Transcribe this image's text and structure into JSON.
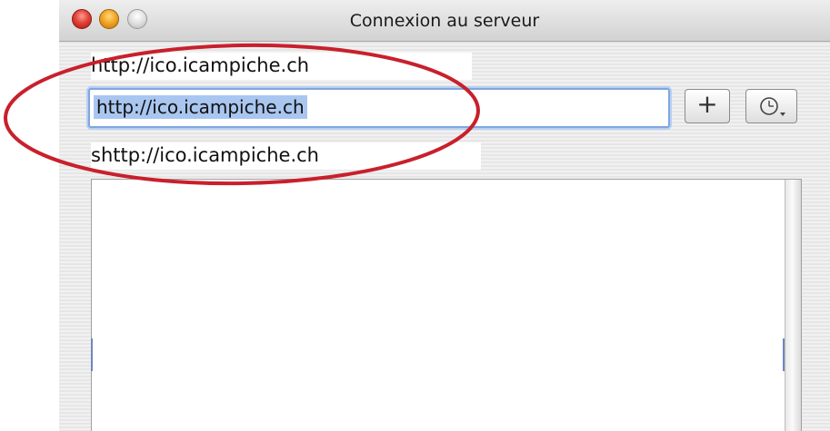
{
  "window": {
    "title": "Connexion au serveur"
  },
  "captions": {
    "top": "http://ico.icampiche.ch",
    "bottom": "shttp://ico.icampiche.ch"
  },
  "address": {
    "value": "http://ico.icampiche.ch"
  },
  "buttons": {
    "add_label": "+",
    "recent_icon": "clock-icon"
  },
  "colors": {
    "annotation": "#c8202c",
    "selection": "#a9c6f0",
    "focus_ring": "#7fa7e0"
  }
}
